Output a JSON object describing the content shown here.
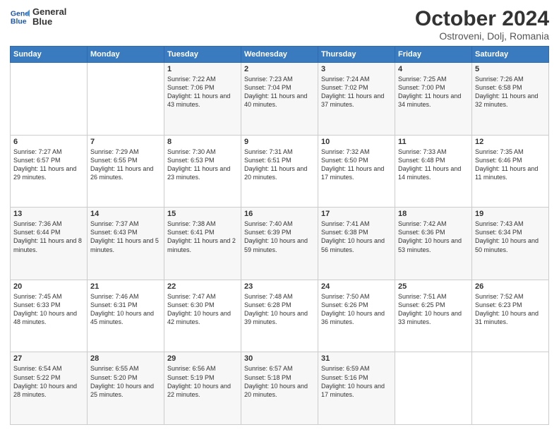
{
  "header": {
    "logo_line1": "General",
    "logo_line2": "Blue",
    "month_title": "October 2024",
    "location": "Ostroveni, Dolj, Romania"
  },
  "weekdays": [
    "Sunday",
    "Monday",
    "Tuesday",
    "Wednesday",
    "Thursday",
    "Friday",
    "Saturday"
  ],
  "weeks": [
    [
      {
        "day": "",
        "info": ""
      },
      {
        "day": "",
        "info": ""
      },
      {
        "day": "1",
        "info": "Sunrise: 7:22 AM\nSunset: 7:06 PM\nDaylight: 11 hours and 43 minutes."
      },
      {
        "day": "2",
        "info": "Sunrise: 7:23 AM\nSunset: 7:04 PM\nDaylight: 11 hours and 40 minutes."
      },
      {
        "day": "3",
        "info": "Sunrise: 7:24 AM\nSunset: 7:02 PM\nDaylight: 11 hours and 37 minutes."
      },
      {
        "day": "4",
        "info": "Sunrise: 7:25 AM\nSunset: 7:00 PM\nDaylight: 11 hours and 34 minutes."
      },
      {
        "day": "5",
        "info": "Sunrise: 7:26 AM\nSunset: 6:58 PM\nDaylight: 11 hours and 32 minutes."
      }
    ],
    [
      {
        "day": "6",
        "info": "Sunrise: 7:27 AM\nSunset: 6:57 PM\nDaylight: 11 hours and 29 minutes."
      },
      {
        "day": "7",
        "info": "Sunrise: 7:29 AM\nSunset: 6:55 PM\nDaylight: 11 hours and 26 minutes."
      },
      {
        "day": "8",
        "info": "Sunrise: 7:30 AM\nSunset: 6:53 PM\nDaylight: 11 hours and 23 minutes."
      },
      {
        "day": "9",
        "info": "Sunrise: 7:31 AM\nSunset: 6:51 PM\nDaylight: 11 hours and 20 minutes."
      },
      {
        "day": "10",
        "info": "Sunrise: 7:32 AM\nSunset: 6:50 PM\nDaylight: 11 hours and 17 minutes."
      },
      {
        "day": "11",
        "info": "Sunrise: 7:33 AM\nSunset: 6:48 PM\nDaylight: 11 hours and 14 minutes."
      },
      {
        "day": "12",
        "info": "Sunrise: 7:35 AM\nSunset: 6:46 PM\nDaylight: 11 hours and 11 minutes."
      }
    ],
    [
      {
        "day": "13",
        "info": "Sunrise: 7:36 AM\nSunset: 6:44 PM\nDaylight: 11 hours and 8 minutes."
      },
      {
        "day": "14",
        "info": "Sunrise: 7:37 AM\nSunset: 6:43 PM\nDaylight: 11 hours and 5 minutes."
      },
      {
        "day": "15",
        "info": "Sunrise: 7:38 AM\nSunset: 6:41 PM\nDaylight: 11 hours and 2 minutes."
      },
      {
        "day": "16",
        "info": "Sunrise: 7:40 AM\nSunset: 6:39 PM\nDaylight: 10 hours and 59 minutes."
      },
      {
        "day": "17",
        "info": "Sunrise: 7:41 AM\nSunset: 6:38 PM\nDaylight: 10 hours and 56 minutes."
      },
      {
        "day": "18",
        "info": "Sunrise: 7:42 AM\nSunset: 6:36 PM\nDaylight: 10 hours and 53 minutes."
      },
      {
        "day": "19",
        "info": "Sunrise: 7:43 AM\nSunset: 6:34 PM\nDaylight: 10 hours and 50 minutes."
      }
    ],
    [
      {
        "day": "20",
        "info": "Sunrise: 7:45 AM\nSunset: 6:33 PM\nDaylight: 10 hours and 48 minutes."
      },
      {
        "day": "21",
        "info": "Sunrise: 7:46 AM\nSunset: 6:31 PM\nDaylight: 10 hours and 45 minutes."
      },
      {
        "day": "22",
        "info": "Sunrise: 7:47 AM\nSunset: 6:30 PM\nDaylight: 10 hours and 42 minutes."
      },
      {
        "day": "23",
        "info": "Sunrise: 7:48 AM\nSunset: 6:28 PM\nDaylight: 10 hours and 39 minutes."
      },
      {
        "day": "24",
        "info": "Sunrise: 7:50 AM\nSunset: 6:26 PM\nDaylight: 10 hours and 36 minutes."
      },
      {
        "day": "25",
        "info": "Sunrise: 7:51 AM\nSunset: 6:25 PM\nDaylight: 10 hours and 33 minutes."
      },
      {
        "day": "26",
        "info": "Sunrise: 7:52 AM\nSunset: 6:23 PM\nDaylight: 10 hours and 31 minutes."
      }
    ],
    [
      {
        "day": "27",
        "info": "Sunrise: 6:54 AM\nSunset: 5:22 PM\nDaylight: 10 hours and 28 minutes."
      },
      {
        "day": "28",
        "info": "Sunrise: 6:55 AM\nSunset: 5:20 PM\nDaylight: 10 hours and 25 minutes."
      },
      {
        "day": "29",
        "info": "Sunrise: 6:56 AM\nSunset: 5:19 PM\nDaylight: 10 hours and 22 minutes."
      },
      {
        "day": "30",
        "info": "Sunrise: 6:57 AM\nSunset: 5:18 PM\nDaylight: 10 hours and 20 minutes."
      },
      {
        "day": "31",
        "info": "Sunrise: 6:59 AM\nSunset: 5:16 PM\nDaylight: 10 hours and 17 minutes."
      },
      {
        "day": "",
        "info": ""
      },
      {
        "day": "",
        "info": ""
      }
    ]
  ]
}
